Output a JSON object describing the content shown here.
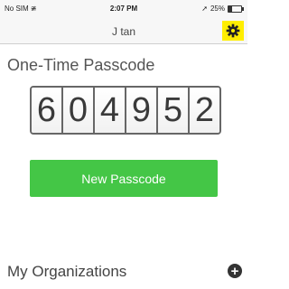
{
  "status_bar": {
    "carrier": "No SIM",
    "time": "2:07 PM",
    "battery": "25%",
    "battery_level": 0.25
  },
  "nav": {
    "title": "J tan",
    "settings_icon": "gear-icon"
  },
  "passcode": {
    "heading": "One-Time Passcode",
    "digits": [
      "6",
      "0",
      "4",
      "9",
      "5",
      "2"
    ]
  },
  "new_passcode_button": "New Passcode",
  "organizations": {
    "heading": "My Organizations",
    "add_icon": "plus-icon"
  },
  "colors": {
    "accent_green": "#44c646",
    "highlight_yellow": "#ffee00"
  }
}
